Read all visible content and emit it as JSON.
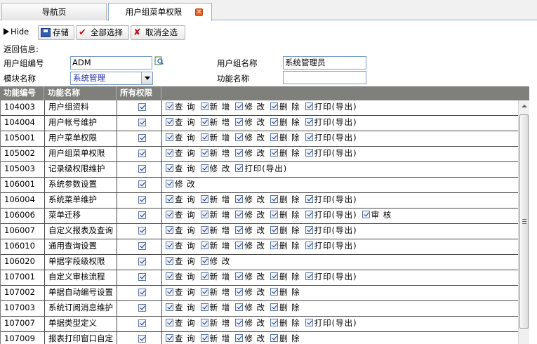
{
  "tabs": [
    {
      "label": "导航页",
      "active": false
    },
    {
      "label": "用户组菜单权限",
      "active": true
    }
  ],
  "toolbar": {
    "hide_label": "Hide",
    "save_label": "存储",
    "select_all_label": "全部选择",
    "deselect_all_label": "取消全选"
  },
  "form": {
    "return_info_label": "返回信息:",
    "group_code_label": "用户组编号",
    "group_code_value": "ADM",
    "group_name_label": "用户组名称",
    "group_name_value": "系统管理员",
    "module_label": "模块名称",
    "module_value": "系统管理",
    "function_label": "功能名称",
    "function_value": ""
  },
  "grid": {
    "columns": [
      "功能编号",
      "功能名称",
      "所有权限"
    ],
    "rows": [
      {
        "code": "104003",
        "name": "用户组资料",
        "perms": [
          "查 询",
          "新 增",
          "修 改",
          "删 除",
          "打印(导出)"
        ]
      },
      {
        "code": "104004",
        "name": "用户帐号维护",
        "perms": [
          "查 询",
          "新 增",
          "修 改",
          "删 除",
          "打印(导出)"
        ]
      },
      {
        "code": "105001",
        "name": "用户菜单权限",
        "perms": [
          "查 询",
          "新 增",
          "修 改",
          "删 除",
          "打印(导出)"
        ]
      },
      {
        "code": "105002",
        "name": "用户组菜单权限",
        "perms": [
          "查 询",
          "新 增",
          "修 改",
          "删 除",
          "打印(导出)"
        ]
      },
      {
        "code": "105003",
        "name": "记录级权限维护",
        "perms": [
          "查 询",
          "修 改",
          "打印(导出)"
        ]
      },
      {
        "code": "106001",
        "name": "系统参数设置",
        "perms": [
          "修 改"
        ]
      },
      {
        "code": "106004",
        "name": "系统菜单维护",
        "perms": [
          "查 询",
          "新 增",
          "修 改",
          "删 除",
          "打印(导出)"
        ]
      },
      {
        "code": "106006",
        "name": "菜单迁移",
        "perms": [
          "查 询",
          "新 增",
          "修 改",
          "删 除",
          "打印(导出)",
          "审 核"
        ]
      },
      {
        "code": "106007",
        "name": "自定义报表及查询",
        "perms": [
          "查 询",
          "新 增",
          "修 改",
          "删 除",
          "打印(导出)"
        ]
      },
      {
        "code": "106010",
        "name": "通用查询设置",
        "perms": [
          "查 询",
          "新 增",
          "修 改",
          "删 除",
          "打印(导出)"
        ]
      },
      {
        "code": "106020",
        "name": "单据字段级权限",
        "perms": [
          "查 询",
          "修 改"
        ]
      },
      {
        "code": "107001",
        "name": "自定义审核流程",
        "perms": [
          "查 询",
          "新 增",
          "修 改",
          "删 除",
          "打印(导出)"
        ]
      },
      {
        "code": "107002",
        "name": "单据自动编号设置",
        "perms": [
          "查 询",
          "新 增",
          "修 改",
          "删 除"
        ]
      },
      {
        "code": "107003",
        "name": "系统订阅消息维护",
        "perms": [
          "查 询",
          "新 增",
          "修 改",
          "删 除"
        ]
      },
      {
        "code": "107007",
        "name": "单据类型定义",
        "perms": [
          "查 询",
          "新 增",
          "修 改",
          "删 除",
          "打印(导出)"
        ]
      },
      {
        "code": "107009",
        "name": "报表打印窗口自定",
        "perms": [
          "查 询",
          "新 增",
          "修 改",
          "删 除"
        ]
      }
    ]
  }
}
